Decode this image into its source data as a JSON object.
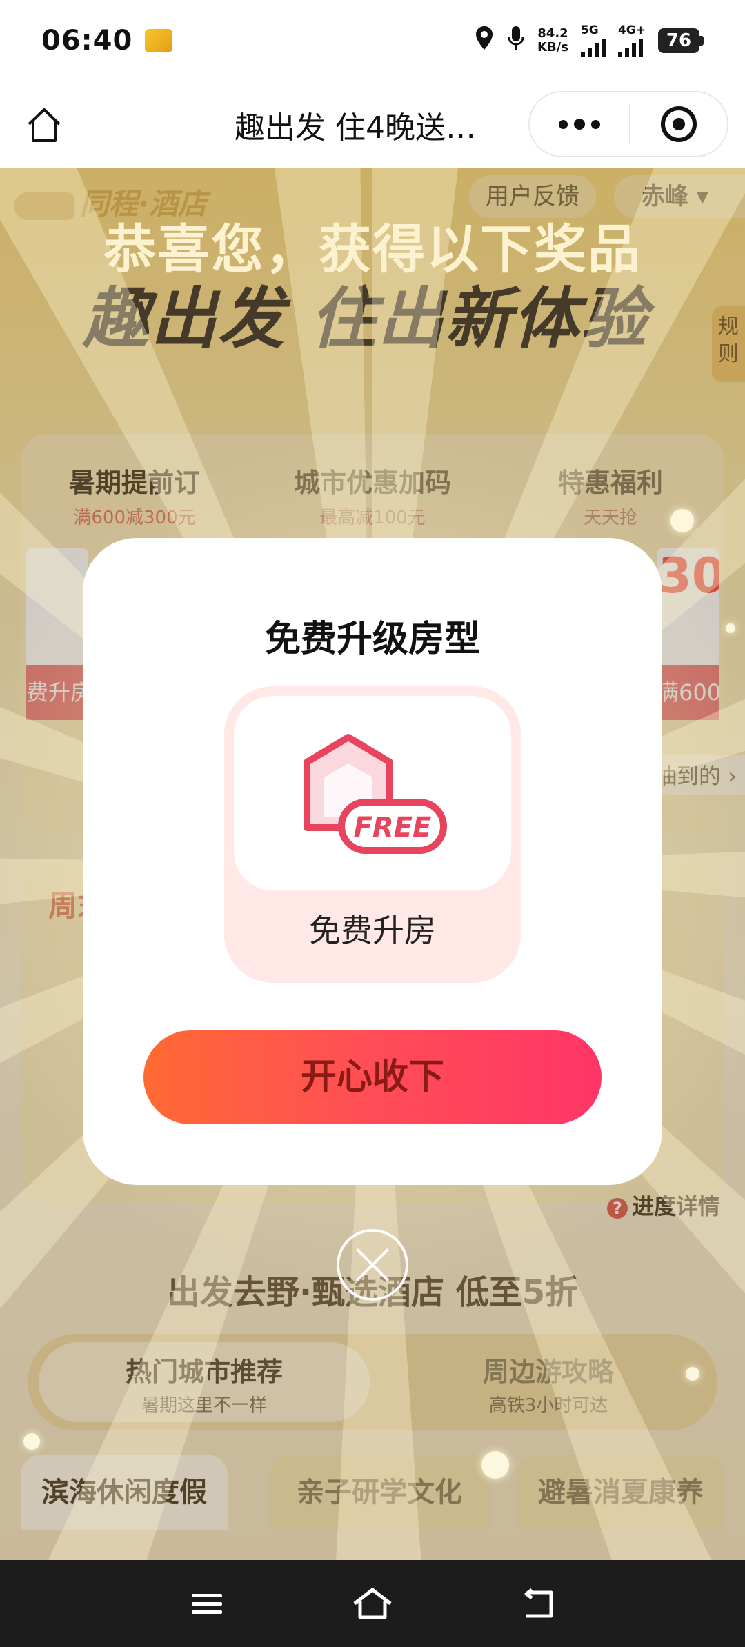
{
  "status_bar": {
    "time": "06:40",
    "speed_value": "84.2",
    "speed_unit": "KB/s",
    "net1": "5G",
    "net2": "4G+",
    "battery": "76"
  },
  "nav": {
    "title": "趣出发 住4晚送…"
  },
  "page": {
    "logo": "同程·酒店",
    "feedback": "用户反馈",
    "city": "赤峰 ▾",
    "hero_title": "趣出发 住出新体验",
    "rules": "规则",
    "congrats": "恭喜您，获得以下奖品",
    "tabs": [
      {
        "title": "暑期提前订",
        "sub": "满600减300元"
      },
      {
        "title": "城市优惠加码",
        "sub": "最高减100元"
      },
      {
        "title": "特惠福利",
        "sub": "天天抢"
      }
    ],
    "left_card_tag": "费升房",
    "right_card_num": "30",
    "right_card_tag": "满600",
    "collected": "抽到的 ›",
    "weekend_label": "周末",
    "progress": "进度详情",
    "banner": "出发去野·甄选酒店 低至5折",
    "recommend": [
      {
        "title": "热门城市推荐",
        "sub": "暑期这里不一样"
      },
      {
        "title": "周边游攻略",
        "sub": "高铁3小时可达"
      }
    ],
    "categories": [
      "滨海休闲度假",
      "亲子研学文化",
      "避暑消夏康养"
    ]
  },
  "modal": {
    "title": "免费升级房型",
    "prize_name": "免费升房",
    "badge_text": "FREE",
    "accept": "开心收下"
  },
  "colors": {
    "accent": "#ff4d57",
    "brand": "#f7d36c",
    "badge": "#e8445e"
  }
}
